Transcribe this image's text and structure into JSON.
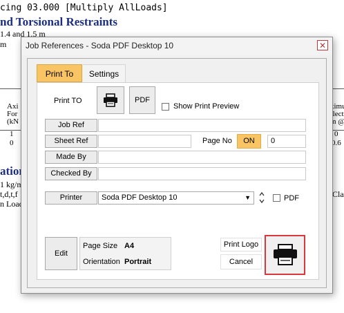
{
  "background": {
    "line1": "cing 03.000 [Multiply AllLoads]",
    "line2": "nd Torsional Restraints",
    "line3": "1.4 and 1.5 m",
    "line4": "m",
    "col_left": [
      "Axi",
      "For",
      "(kN",
      "1",
      "0"
    ],
    "col_right": [
      "ximu",
      "flecti",
      "m @",
      "0",
      "0.6"
    ],
    "heading2": "ation",
    "line5": "1 kg/m",
    "line6": "t,d,t,f",
    "line7": "n Load",
    "right_fragment": "Clas"
  },
  "dialog": {
    "title": "Job References - Soda PDF Desktop 10",
    "close_glyph": "✕",
    "tabs": [
      {
        "label": "Print To",
        "active": true
      },
      {
        "label": "Settings",
        "active": false
      }
    ],
    "print_to_label": "Print TO",
    "pdf_button": "PDF",
    "show_preview_label": "Show Print Preview",
    "show_preview_checked": false,
    "job_ref": {
      "label": "Job Ref",
      "value": ""
    },
    "sheet_ref": {
      "label": "Sheet Ref",
      "value": ""
    },
    "page_no": {
      "label": "Page No",
      "toggle": "ON",
      "value": "0"
    },
    "made_by": {
      "label": "Made By",
      "value": ""
    },
    "checked_by": {
      "label": "Checked By",
      "value": ""
    },
    "printer": {
      "button": "Printer",
      "selected": "Soda PDF Desktop 10",
      "pdf_label": "PDF",
      "pdf_checked": false
    },
    "edit_button": "Edit",
    "page_size": {
      "label": "Page Size",
      "value": "A4"
    },
    "orientation": {
      "label": "Orientation",
      "value": "Portrait"
    },
    "print_logo_button": "Print Logo",
    "cancel_button": "Cancel",
    "icons": {
      "print": "printer-icon",
      "large_print": "printer-icon",
      "spin": "spin-arrows-icon"
    }
  }
}
